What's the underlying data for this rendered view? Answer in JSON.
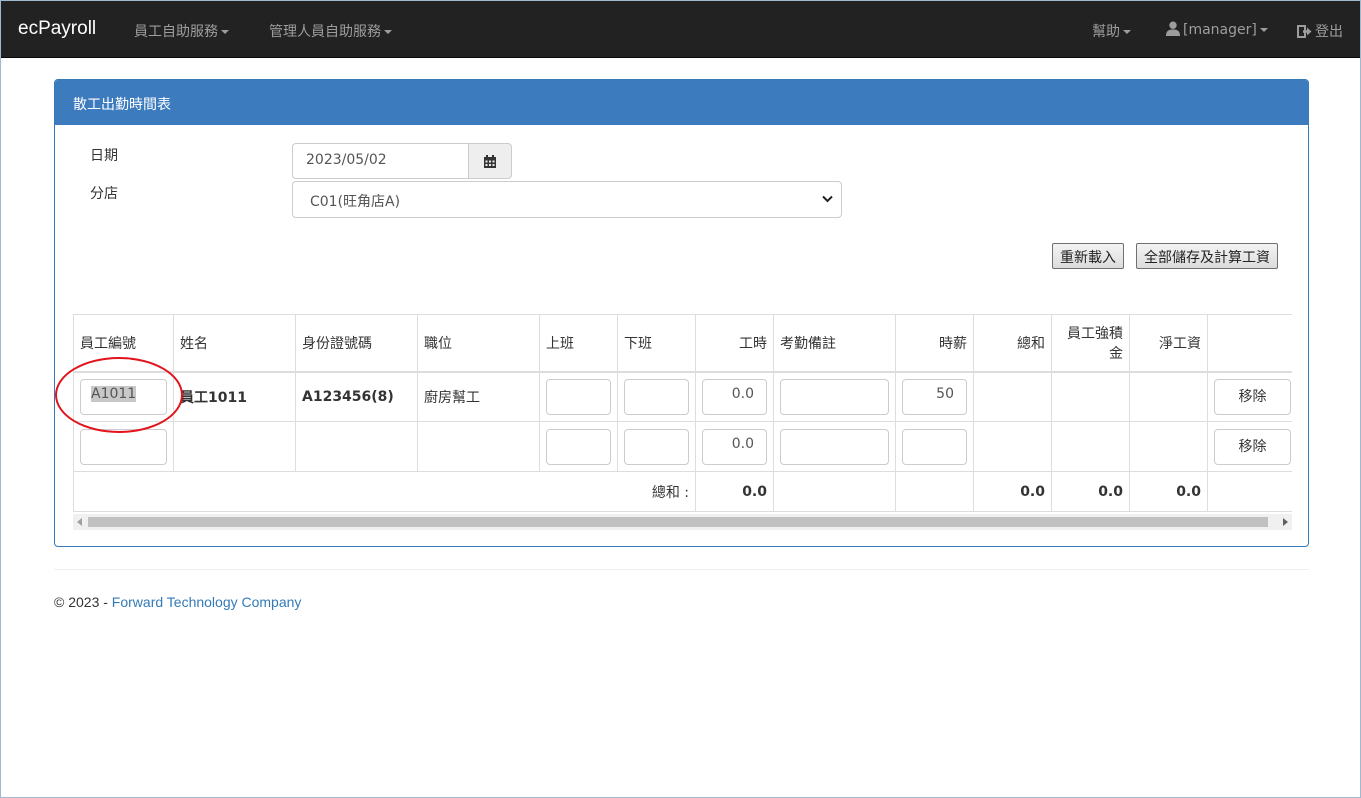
{
  "navbar": {
    "brand": "ecPayroll",
    "menu_employee": "員工自助服務",
    "menu_manager": "管理人員自助服務",
    "help": "幫助",
    "user": "[manager]",
    "logout": "登出"
  },
  "panel": {
    "title": "散工出勤時間表",
    "date_label": "日期",
    "date_value": "2023/05/02",
    "branch_label": "分店",
    "branch_selected": "C01(旺角店A)",
    "reload_button": "重新載入",
    "save_all_button": "全部儲存及計算工資"
  },
  "table": {
    "headers": {
      "emp_id": "員工編號",
      "name": "姓名",
      "id_no": "身份證號碼",
      "position": "職位",
      "start": "上班",
      "end": "下班",
      "hours": "工時",
      "remark": "考勤備註",
      "rate": "時薪",
      "total": "總和",
      "mpf": "員工強積金",
      "net": "淨工資"
    },
    "rows": [
      {
        "emp_id": "A1011",
        "name": "員工1011",
        "id_no": "A123456(8)",
        "position": "廚房幫工",
        "start": "",
        "end": "",
        "hours": "0.0",
        "remark": "",
        "rate": "50",
        "total": "",
        "mpf": "",
        "net": "",
        "remove": "移除"
      },
      {
        "emp_id": "",
        "name": "",
        "id_no": "",
        "position": "",
        "start": "",
        "end": "",
        "hours": "0.0",
        "remark": "",
        "rate": "",
        "total": "",
        "mpf": "",
        "net": "",
        "remove": "移除"
      }
    ],
    "footer": {
      "label": "總和 :",
      "hours": "0.0",
      "total": "0.0",
      "mpf": "0.0",
      "net": "0.0"
    }
  },
  "footer": {
    "copyright": "© 2023 - ",
    "company": "Forward Technology Company"
  },
  "colors": {
    "navbar": "#222222",
    "panel_heading": "#3d7bbf",
    "link": "#337ab7",
    "annotation": "#e2131b"
  }
}
